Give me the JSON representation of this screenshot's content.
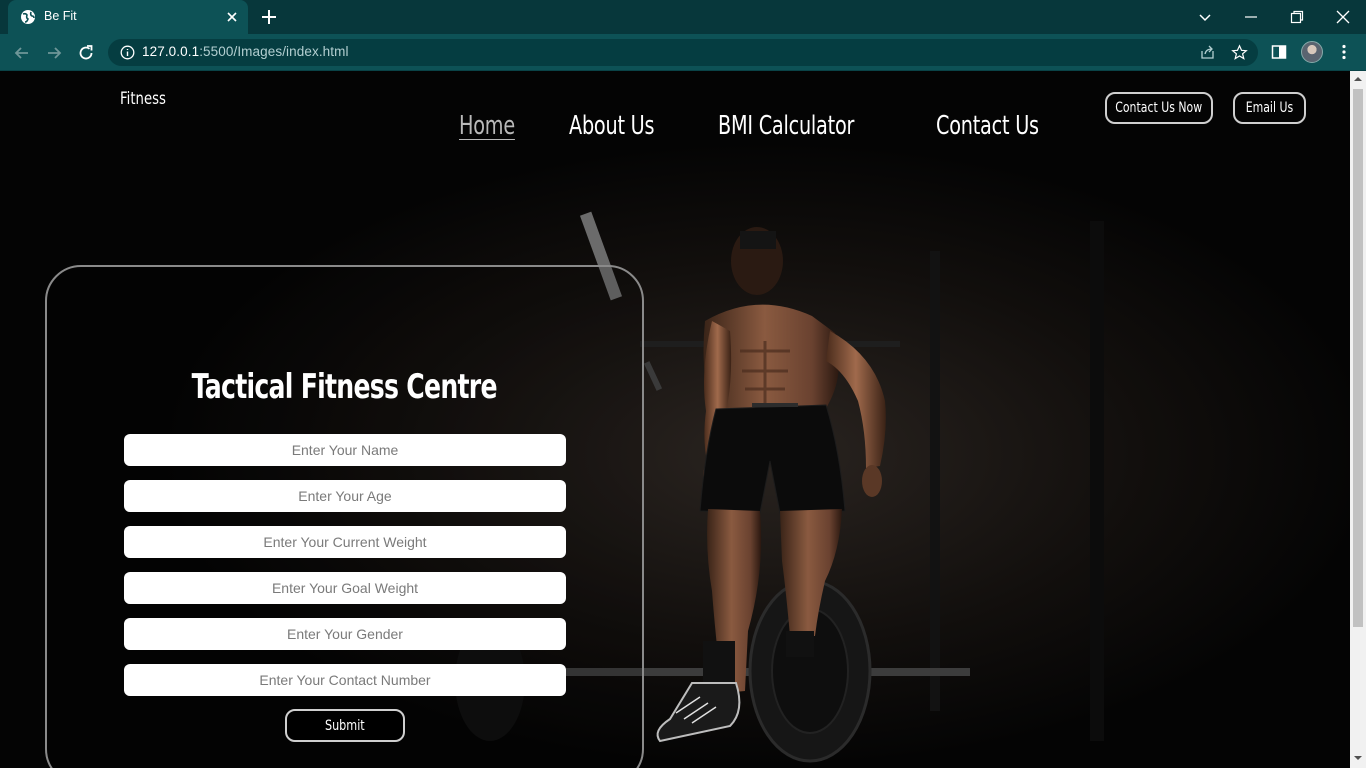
{
  "browser": {
    "tab_title": "Be Fit",
    "url_host": "127.0.0.1",
    "url_rest": ":5500/Images/index.html"
  },
  "site": {
    "brand": "Fitness",
    "nav": [
      {
        "label": "Home",
        "active": true
      },
      {
        "label": "About Us",
        "active": false
      },
      {
        "label": "BMI Calculator",
        "active": false
      },
      {
        "label": "Contact Us",
        "active": false
      }
    ],
    "buttons": {
      "contact_now": "Contact Us Now",
      "email": "Email Us"
    }
  },
  "form": {
    "title": "Tactical Fitness Centre",
    "fields": [
      {
        "placeholder": "Enter Your Name"
      },
      {
        "placeholder": "Enter Your Age"
      },
      {
        "placeholder": "Enter Your Current Weight"
      },
      {
        "placeholder": "Enter Your Goal Weight"
      },
      {
        "placeholder": "Enter Your Gender"
      },
      {
        "placeholder": "Enter Your Contact Number"
      }
    ],
    "submit_label": "Submit"
  },
  "colors": {
    "chrome_dark": "#07373b",
    "chrome_light": "#0d5256",
    "page_bg": "#040404"
  }
}
